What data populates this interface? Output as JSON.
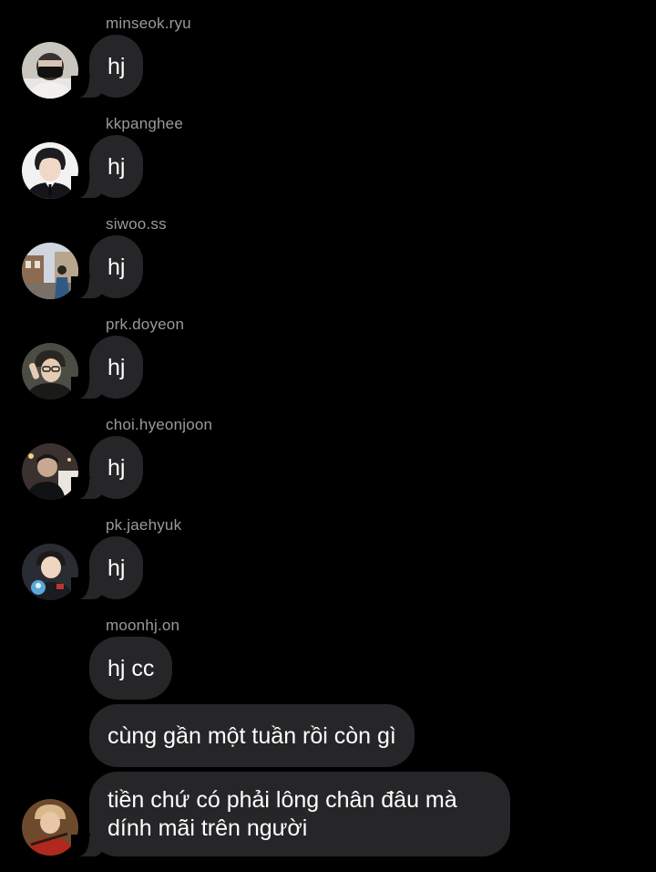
{
  "messages": [
    {
      "username": "minseok.ryu",
      "text": "hj",
      "avatar": "avatar-masked-person"
    },
    {
      "username": "kkpanghee",
      "text": "hj",
      "avatar": "avatar-person-suit"
    },
    {
      "username": "siwoo.ss",
      "text": "hj",
      "avatar": "avatar-person-street"
    },
    {
      "username": "prk.doyeon",
      "text": "hj",
      "avatar": "avatar-person-glasses"
    },
    {
      "username": "choi.hyeonjoon",
      "text": "hj",
      "avatar": "avatar-person-dark"
    },
    {
      "username": "pk.jaehyuk",
      "text": "hj",
      "avatar": "avatar-person-plush"
    }
  ],
  "group": {
    "username": "moonhj.on",
    "avatar": "avatar-person-red",
    "texts": [
      "hj cc",
      "cùng gần một tuần rồi còn gì",
      "tiền chứ có phải lông chân đâu mà dính mãi trên người"
    ]
  },
  "colors": {
    "background": "#000000",
    "bubble": "#262628",
    "username": "#9a9a9a",
    "text": "#ffffff"
  }
}
